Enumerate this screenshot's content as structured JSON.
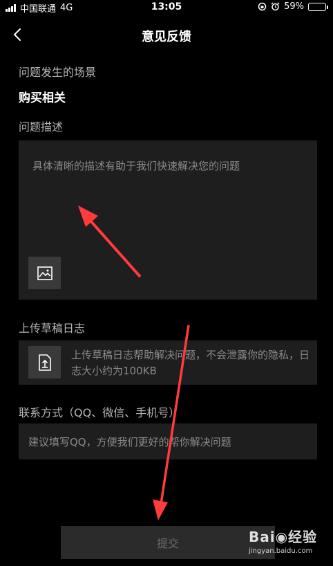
{
  "status_bar": {
    "carrier": "中国联通",
    "network": "4G",
    "time": "13:05",
    "battery": "59%",
    "battery_level": 0.59,
    "battery_color": "#3dd84d"
  },
  "nav": {
    "title": "意见反馈"
  },
  "scene": {
    "label": "问题发生的场景",
    "value": "购买相关"
  },
  "description": {
    "label": "问题描述",
    "placeholder": "具体清晰的描述有助于我们快速解决您的问题",
    "image_icon": "image-icon"
  },
  "upload": {
    "label": "上传草稿日志",
    "text": "上传草稿日志帮助解决问题，不会泄露你的隐私，日志大小约为100KB",
    "icon": "upload-icon"
  },
  "contact": {
    "label": "联系方式（QQ、微信、手机号）",
    "placeholder": "建议填写QQ，方便我们更好的帮你解决问题"
  },
  "submit": {
    "label": "提交"
  },
  "watermark": {
    "logo": "Bai◉经验",
    "url": "jingyan.baidu.com"
  },
  "annotation_color": "#ff3b3b"
}
